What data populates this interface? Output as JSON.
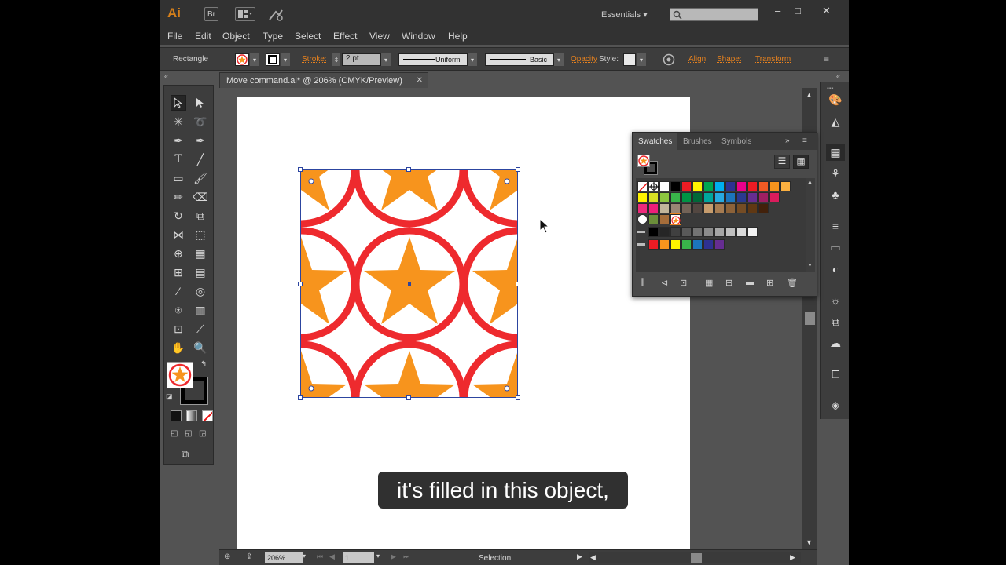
{
  "titlebar": {
    "logo": "Ai",
    "bridge_button": "Br",
    "workspace": "Essentials",
    "workspace_caret": "▾",
    "window_controls": [
      "–",
      "□",
      "✕"
    ]
  },
  "menubar": {
    "items": [
      "File",
      "Edit",
      "Object",
      "Type",
      "Select",
      "Effect",
      "View",
      "Window",
      "Help"
    ]
  },
  "controlbar": {
    "selection_type": "Rectangle",
    "stroke_label": "Stroke:",
    "stroke_weight": "2 pt",
    "profile": "Uniform",
    "brush": "Basic",
    "opacity_label": "Opacity",
    "style_label": "Style:",
    "align_label": "Align",
    "shape_label": "Shape:",
    "transform_label": "Transform"
  },
  "document": {
    "tab_title": "Move command.ai* @ 206% (CMYK/Preview)",
    "close": "✕"
  },
  "statusbar": {
    "zoom": "206%",
    "page": "1",
    "tool": "Selection"
  },
  "swatches_panel": {
    "tabs": [
      "Swatches",
      "Brushes",
      "Symbols"
    ],
    "row1": [
      "#ffffff",
      "#000000",
      "#ee1c24",
      "#fff200",
      "#00a651",
      "#00aeef",
      "#2e3192",
      "#ec008c",
      "#ed1c24",
      "#f15a24",
      "#f7941d",
      "#fbb040"
    ],
    "row2": [
      "#fff200",
      "#d7df23",
      "#8dc63f",
      "#39b54a",
      "#009444",
      "#006838",
      "#00a79d",
      "#27aae1",
      "#1c75bc",
      "#2b3990",
      "#662d91",
      "#9e1f63",
      "#da1c5c"
    ],
    "row3": [
      "#ee2a7b",
      "#ed1e79",
      "#c2b59b",
      "#998675",
      "#736357",
      "#534741",
      "#c69c6d",
      "#a67c52",
      "#8c6239",
      "#754c24",
      "#603813",
      "#42210b"
    ],
    "row5": [
      "#000000",
      "#262626",
      "#404040",
      "#595959",
      "#737373",
      "#8c8c8c",
      "#a6a6a6",
      "#bfbfbf",
      "#d9d9d9",
      "#f2f2f2"
    ],
    "row6": [
      "#ee1c24",
      "#f7941d",
      "#fff200",
      "#39b54a",
      "#1c75bc",
      "#2e3192",
      "#662d91"
    ]
  },
  "colors": {
    "accent": "#e8821e",
    "ring": "#ee2a2e",
    "star": "#f7941d",
    "selection": "#2c45a0"
  },
  "caption": "it's filled in this object,"
}
